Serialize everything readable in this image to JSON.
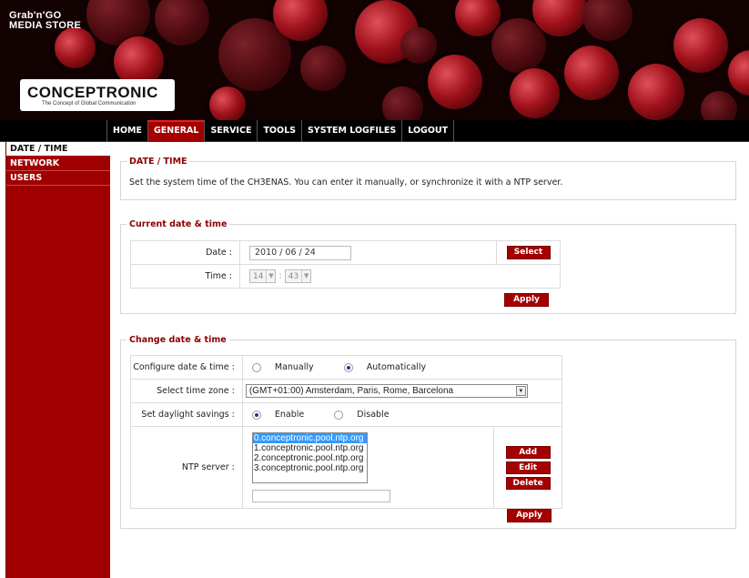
{
  "header": {
    "store_title_line1": "Grab'n'GO",
    "store_title_line2": "MEDIA STORE",
    "logo_text": "CONCEPTRONIC",
    "logo_tagline": "The Concept of Global Communication"
  },
  "nav": {
    "items": [
      "HOME",
      "GENERAL",
      "SERVICE",
      "TOOLS",
      "SYSTEM LOGFILES",
      "LOGOUT"
    ],
    "active": "GENERAL"
  },
  "sidebar": {
    "items": [
      "DATE / TIME",
      "NETWORK",
      "USERS"
    ],
    "active": "DATE / TIME"
  },
  "datetime_panel": {
    "legend": "DATE / TIME",
    "description": "Set the system time of the CH3ENAS. You can enter it manually, or synchronize it with a NTP server."
  },
  "current_panel": {
    "legend": "Current date & time",
    "date_label": "Date :",
    "date_value": "2010 / 06 / 24",
    "select_button": "Select",
    "time_label": "Time :",
    "hour_value": "14",
    "minute_value": "43",
    "time_separator": ":",
    "apply_button": "Apply"
  },
  "change_panel": {
    "legend": "Change date & time",
    "configure_label": "Configure date & time :",
    "manual_option": "Manually",
    "auto_option": "Automatically",
    "selected_mode": "Automatically",
    "timezone_label": "Select time zone :",
    "timezone_value": "(GMT+01:00) Amsterdam, Paris, Rome, Barcelona",
    "daylight_label": "Set daylight savings :",
    "enable_option": "Enable",
    "disable_option": "Disable",
    "daylight_selected": "Enable",
    "ntp_label": "NTP server :",
    "ntp_servers": [
      "0.conceptronic.pool.ntp.org",
      "1.conceptronic.pool.ntp.org",
      "2.conceptronic.pool.ntp.org",
      "3.conceptronic.pool.ntp.org"
    ],
    "ntp_selected_index": 0,
    "ntp_input_value": "",
    "add_button": "Add",
    "edit_button": "Edit",
    "delete_button": "Delete",
    "apply_button": "Apply"
  },
  "colors": {
    "accent_red": "#a50000",
    "legend_red": "#8b0000",
    "nav_black": "#000000"
  }
}
